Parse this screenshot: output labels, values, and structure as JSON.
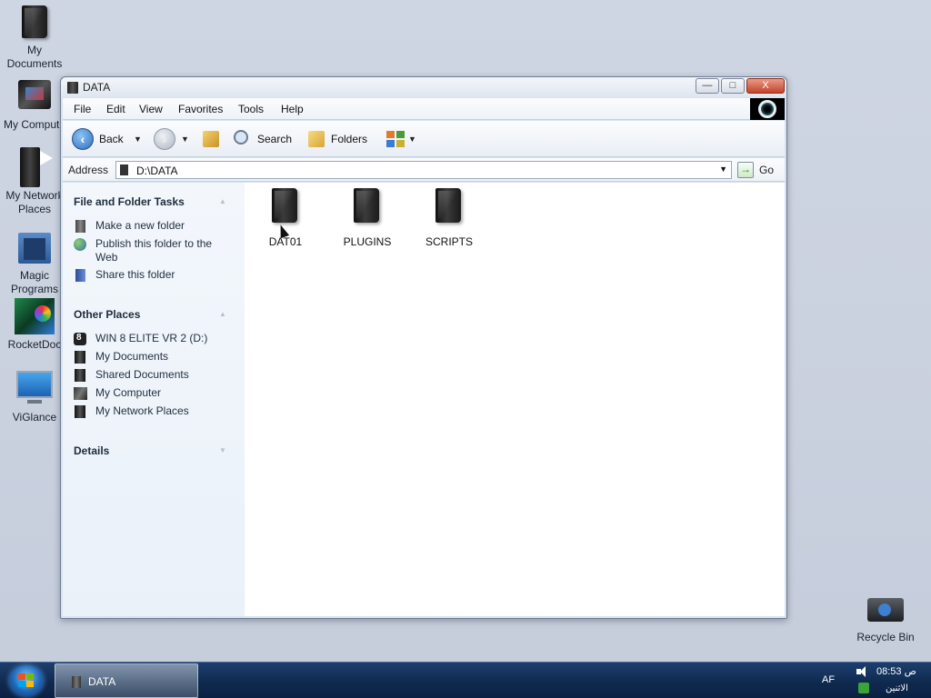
{
  "desktop": {
    "icons": [
      {
        "label": "My Documents",
        "icon": "dark-folder-icon"
      },
      {
        "label": "My Compute",
        "icon": "computer-icon"
      },
      {
        "label": "My Network Places",
        "icon": "network-icon"
      },
      {
        "label": "Magic Programs",
        "icon": "castle-icon"
      },
      {
        "label": "RocketDoc",
        "icon": "rocketdock-icon"
      },
      {
        "label": "ViGlance",
        "icon": "monitor-icon"
      },
      {
        "label": "Recycle Bin",
        "icon": "recycle-bin-icon"
      }
    ]
  },
  "window": {
    "title": "DATA",
    "controls": {
      "minimize": "—",
      "maximize": "□",
      "close": "X"
    },
    "menu": [
      "File",
      "Edit",
      "View",
      "Favorites",
      "Tools",
      "Help"
    ],
    "toolbar": {
      "back": "Back",
      "search": "Search",
      "folders": "Folders"
    },
    "address": {
      "label": "Address",
      "value": "D:\\DATA",
      "go": "Go"
    },
    "taskpane": {
      "file_tasks": {
        "title": "File and Folder Tasks",
        "items": [
          "Make a new folder",
          "Publish this folder to the Web",
          "Share this folder"
        ]
      },
      "other_places": {
        "title": "Other Places",
        "items": [
          "WIN 8 ELITE VR 2 (D:)",
          "My Documents",
          "Shared Documents",
          "My Computer",
          "My Network Places"
        ]
      },
      "details": {
        "title": "Details"
      }
    },
    "files": [
      "DAT01",
      "PLUGINS",
      "SCRIPTS"
    ]
  },
  "taskbar": {
    "task_label": "DATA",
    "language": "AF",
    "time": "08:53 ص",
    "day": "الاثنين"
  }
}
